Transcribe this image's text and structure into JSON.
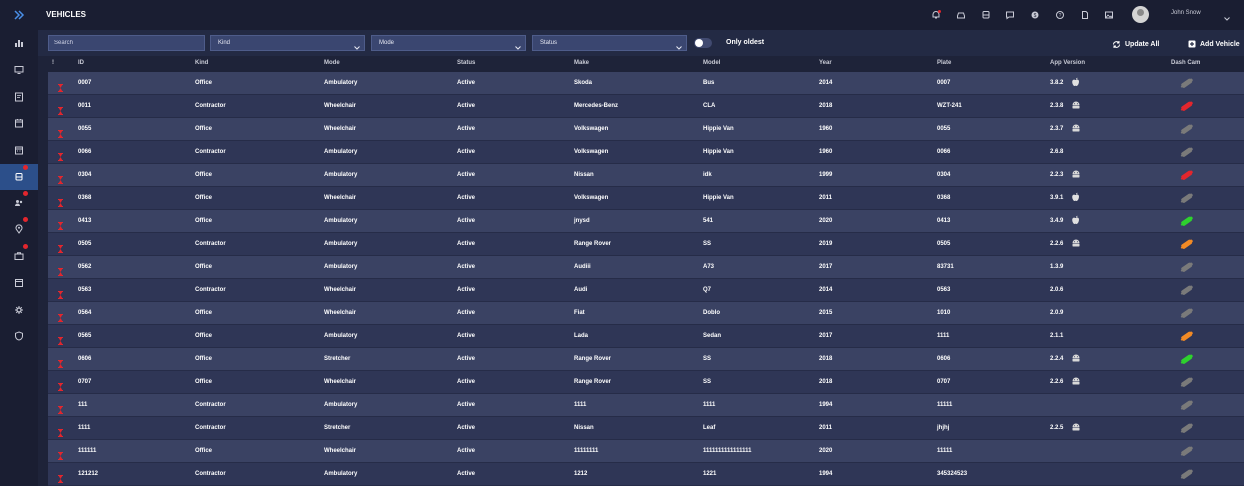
{
  "header": {
    "title": "VEHICLES",
    "user_name": "John Snow"
  },
  "toolbar": {
    "search_placeholder": "Search",
    "filters": [
      {
        "name": "kind-select",
        "label": "Kind"
      },
      {
        "name": "mode-select",
        "label": "Mode"
      },
      {
        "name": "status-select",
        "label": "Status"
      }
    ],
    "only_oldest_label": "Only oldest",
    "update_all_label": "Update All",
    "add_vehicle_label": "Add Vehicle"
  },
  "colors": {
    "sidebar_bg": "#1a1e32",
    "row_odd": "#3a4263",
    "row_even": "#2f3656",
    "accent_active": "#2c4f8a",
    "hourglass": "#e3262d",
    "cam_gray": "#7a7a7a",
    "cam_red": "#e3262d",
    "cam_green": "#2ed12e",
    "cam_orange": "#f28a25"
  },
  "table": {
    "columns": [
      "!",
      "ID",
      "Kind",
      "Mode",
      "Status",
      "Make",
      "Model",
      "Year",
      "Plate",
      "App Version",
      "Dash Cam"
    ],
    "rows": [
      {
        "id": "0007",
        "kind": "Office",
        "mode": "Ambulatory",
        "status": "Active",
        "make": "Skoda",
        "model": "Bus",
        "year": "2014",
        "plate": "0007",
        "version": "3.8.2",
        "os": "apple-icon",
        "cam": "gray"
      },
      {
        "id": "0011",
        "kind": "Contractor",
        "mode": "Wheelchair",
        "status": "Active",
        "make": "Mercedes-Benz",
        "model": "CLA",
        "year": "2018",
        "plate": "WZT-241",
        "version": "2.3.8",
        "os": "android-icon",
        "cam": "red"
      },
      {
        "id": "0055",
        "kind": "Office",
        "mode": "Wheelchair",
        "status": "Active",
        "make": "Volkswagen",
        "model": "Hippie Van",
        "year": "1960",
        "plate": "0055",
        "version": "2.3.7",
        "os": "android-icon",
        "cam": "gray"
      },
      {
        "id": "0066",
        "kind": "Contractor",
        "mode": "Ambulatory",
        "status": "Active",
        "make": "Volkswagen",
        "model": "Hippie Van",
        "year": "1960",
        "plate": "0066",
        "version": "2.6.8",
        "os": "",
        "cam": "gray"
      },
      {
        "id": "0304",
        "kind": "Office",
        "mode": "Ambulatory",
        "status": "Active",
        "make": "Nissan",
        "model": "idk",
        "year": "1999",
        "plate": "0304",
        "version": "2.2.3",
        "os": "android-icon",
        "cam": "red"
      },
      {
        "id": "0368",
        "kind": "Office",
        "mode": "Wheelchair",
        "status": "Active",
        "make": "Volkswagen",
        "model": "Hippie Van",
        "year": "2011",
        "plate": "0368",
        "version": "3.9.1",
        "os": "apple-icon",
        "cam": "gray"
      },
      {
        "id": "0413",
        "kind": "Office",
        "mode": "Ambulatory",
        "status": "Active",
        "make": "jnysd",
        "model": "541",
        "year": "2020",
        "plate": "0413",
        "version": "3.4.9",
        "os": "apple-icon",
        "cam": "green"
      },
      {
        "id": "0505",
        "kind": "Contractor",
        "mode": "Ambulatory",
        "status": "Active",
        "make": "Range Rover",
        "model": "SS",
        "year": "2019",
        "plate": "0505",
        "version": "2.2.6",
        "os": "android-icon",
        "cam": "orange"
      },
      {
        "id": "0562",
        "kind": "Office",
        "mode": "Ambulatory",
        "status": "Active",
        "make": "Audiii",
        "model": "A73",
        "year": "2017",
        "plate": "83731",
        "version": "1.3.9",
        "os": "",
        "cam": "gray"
      },
      {
        "id": "0563",
        "kind": "Contractor",
        "mode": "Wheelchair",
        "status": "Active",
        "make": "Audi",
        "model": "Q7",
        "year": "2014",
        "plate": "0563",
        "version": "2.0.6",
        "os": "",
        "cam": "gray"
      },
      {
        "id": "0564",
        "kind": "Office",
        "mode": "Wheelchair",
        "status": "Active",
        "make": "Fiat",
        "model": "Doblo",
        "year": "2015",
        "plate": "1010",
        "version": "2.0.9",
        "os": "",
        "cam": "gray"
      },
      {
        "id": "0565",
        "kind": "Office",
        "mode": "Ambulatory",
        "status": "Active",
        "make": "Lada",
        "model": "Sedan",
        "year": "2017",
        "plate": "1111",
        "version": "2.1.1",
        "os": "",
        "cam": "orange"
      },
      {
        "id": "0606",
        "kind": "Office",
        "mode": "Stretcher",
        "status": "Active",
        "make": "Range Rover",
        "model": "SS",
        "year": "2018",
        "plate": "0606",
        "version": "2.2.4",
        "os": "android-icon",
        "cam": "green"
      },
      {
        "id": "0707",
        "kind": "Office",
        "mode": "Wheelchair",
        "status": "Active",
        "make": "Range Rover",
        "model": "SS",
        "year": "2018",
        "plate": "0707",
        "version": "2.2.6",
        "os": "android-icon",
        "cam": "gray"
      },
      {
        "id": "111",
        "kind": "Contractor",
        "mode": "Ambulatory",
        "status": "Active",
        "make": "1111",
        "model": "1111",
        "year": "1994",
        "plate": "11111",
        "version": "",
        "os": "",
        "cam": "gray"
      },
      {
        "id": "1111",
        "kind": "Contractor",
        "mode": "Stretcher",
        "status": "Active",
        "make": "Nissan",
        "model": "Leaf",
        "year": "2011",
        "plate": "jhjhj",
        "version": "2.2.5",
        "os": "android-icon",
        "cam": "gray"
      },
      {
        "id": "111111",
        "kind": "Office",
        "mode": "Wheelchair",
        "status": "Active",
        "make": "11111111",
        "model": "1111111111111111",
        "year": "2020",
        "plate": "11111",
        "version": "",
        "os": "",
        "cam": "gray"
      },
      {
        "id": "121212",
        "kind": "Contractor",
        "mode": "Ambulatory",
        "status": "Active",
        "make": "1212",
        "model": "1221",
        "year": "1994",
        "plate": "345324523",
        "version": "",
        "os": "",
        "cam": "gray"
      }
    ]
  },
  "sidebar": {
    "items": [
      {
        "name": "sidebar-item-dashboard",
        "icon": "chart-icon",
        "dot": false,
        "active": false
      },
      {
        "name": "sidebar-item-messages",
        "icon": "monitor-icon",
        "dot": false,
        "active": false
      },
      {
        "name": "sidebar-item-notes",
        "icon": "notes-icon",
        "dot": false,
        "active": false
      },
      {
        "name": "sidebar-item-calendar",
        "icon": "calendar-icon",
        "dot": false,
        "active": false
      },
      {
        "name": "sidebar-item-schedule",
        "icon": "calendar-grid-icon",
        "dot": false,
        "active": false
      },
      {
        "name": "sidebar-item-vehicles",
        "icon": "bus-icon",
        "dot": true,
        "active": true
      },
      {
        "name": "sidebar-item-users",
        "icon": "users-icon",
        "dot": true,
        "active": false
      },
      {
        "name": "sidebar-item-locations",
        "icon": "location-icon",
        "dot": true,
        "active": false
      },
      {
        "name": "sidebar-item-jobs",
        "icon": "briefcase-icon",
        "dot": true,
        "active": false
      },
      {
        "name": "sidebar-item-reports",
        "icon": "window-icon",
        "dot": false,
        "active": false
      },
      {
        "name": "sidebar-item-settings",
        "icon": "gear-icon",
        "dot": false,
        "active": false
      },
      {
        "name": "sidebar-item-security",
        "icon": "shield-icon",
        "dot": false,
        "active": false
      }
    ]
  }
}
